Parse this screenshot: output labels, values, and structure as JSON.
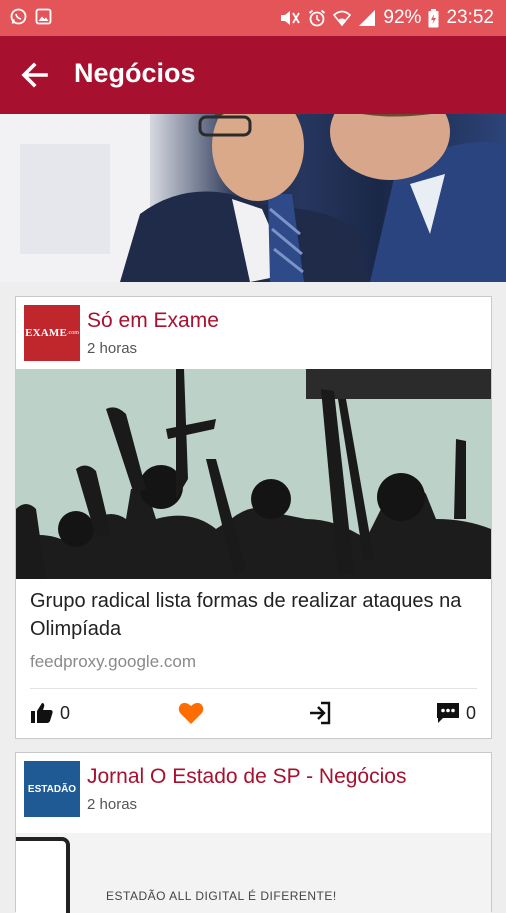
{
  "status_bar": {
    "battery": "92%",
    "time": "23:52"
  },
  "app_bar": {
    "title": "Negócios",
    "back_icon": "arrow-left-icon"
  },
  "feed": [
    {
      "source": "Só em Exame",
      "logo_text": "EXAME",
      "logo_subtext": ".com",
      "logo_color": "#c0272d",
      "time": "2 horas",
      "headline": "Grupo radical lista formas de realizar ataques na Olimpíada",
      "domain": "feedproxy.google.com",
      "likes": "0",
      "comments": "0"
    },
    {
      "source": "Jornal O Estado de SP - Negócios",
      "logo_text": "ESTADÃO",
      "logo_color": "#1f5a95",
      "time": "2 horas",
      "image_caption": "ESTADÃO ALL DIGITAL É DIFERENTE!"
    }
  ],
  "colors": {
    "status_bar": "#e45559",
    "app_bar": "#a8102f",
    "accent": "#ff6d00"
  }
}
